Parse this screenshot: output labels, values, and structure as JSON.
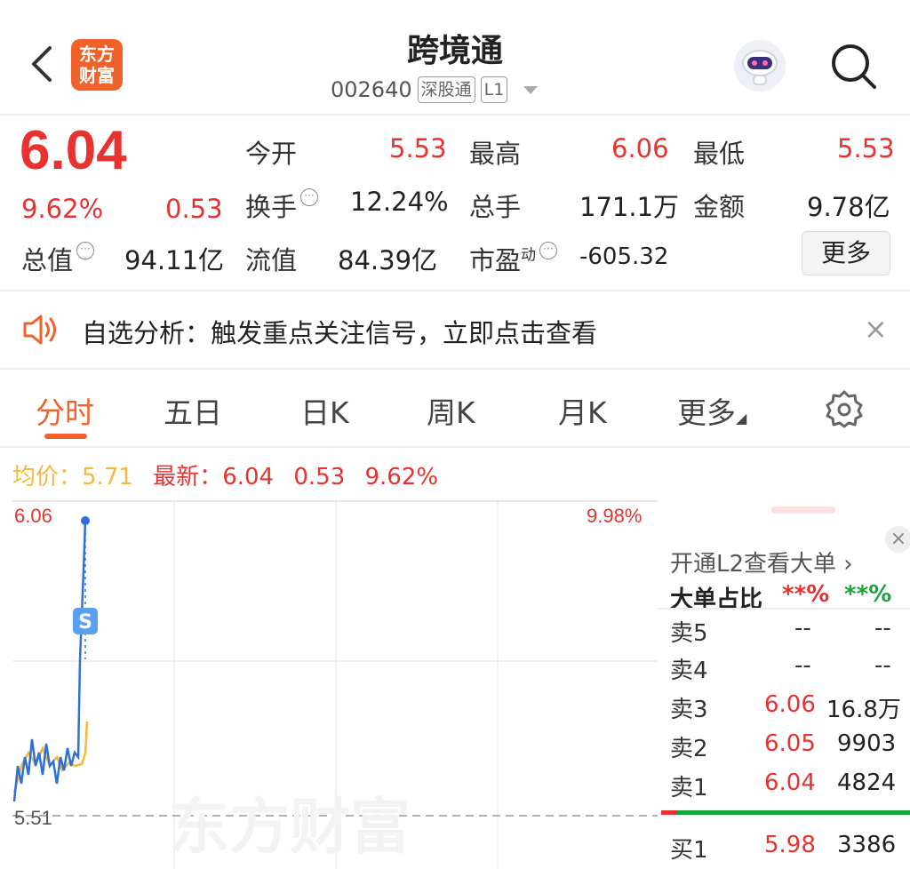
{
  "header": {
    "logo_text_1": "东方",
    "logo_text_2": "财富",
    "stock_name": "跨境通",
    "code": "002640",
    "tag1": "深股通",
    "tag2": "L1"
  },
  "quote": {
    "price": "6.04",
    "change_pct": "9.62%",
    "change": "0.53",
    "open_label": "今开",
    "open": "5.53",
    "high_label": "最高",
    "high": "6.06",
    "low_label": "最低",
    "low": "5.53",
    "turnover_label": "换手",
    "turnover": "12.24%",
    "volume_label": "总手",
    "volume": "171.1万",
    "amount_label": "金额",
    "amount": "9.78亿",
    "mktcap_label": "总值",
    "mktcap": "94.11亿",
    "float_label": "流值",
    "float": "84.39亿",
    "pe_label": "市盈",
    "pe_sup": "动",
    "pe": "-605.32",
    "more_label": "更多"
  },
  "notice": {
    "text": "自选分析：触发重点关注信号，立即点击查看",
    "close": "×"
  },
  "tabs": [
    {
      "label": "分时"
    },
    {
      "label": "五日"
    },
    {
      "label": "日K"
    },
    {
      "label": "周K"
    },
    {
      "label": "月K"
    },
    {
      "label": "更多"
    }
  ],
  "priceline": {
    "avg_label": "均价：",
    "avg": "5.71",
    "latest_label": "最新：",
    "latest": "6.04",
    "chg": "0.53",
    "pct": "9.62%"
  },
  "chart": {
    "top_price": "6.06",
    "top_pct": "9.98%",
    "base_price": "5.51",
    "marker": "S",
    "watermark": "东方财富"
  },
  "book": {
    "promo": "开通L2查看大单 ›",
    "ratio_label": "大单占比",
    "ratio_red": "**%",
    "ratio_green": "**%",
    "rows": [
      {
        "label": "卖5",
        "price": "--",
        "vol": "--"
      },
      {
        "label": "卖4",
        "price": "--",
        "vol": "--"
      },
      {
        "label": "卖3",
        "price": "6.06",
        "vol": "16.8万"
      },
      {
        "label": "卖2",
        "price": "6.05",
        "vol": "9903"
      },
      {
        "label": "卖1",
        "price": "6.04",
        "vol": "4824"
      },
      {
        "label": "买1",
        "price": "5.98",
        "vol": "3386"
      }
    ]
  },
  "colors": {
    "up": "#e8322f",
    "down": "#1aa33a",
    "accent": "#f0622a",
    "price_line": "#2e6fd8",
    "avg_line": "#f5b83a"
  }
}
